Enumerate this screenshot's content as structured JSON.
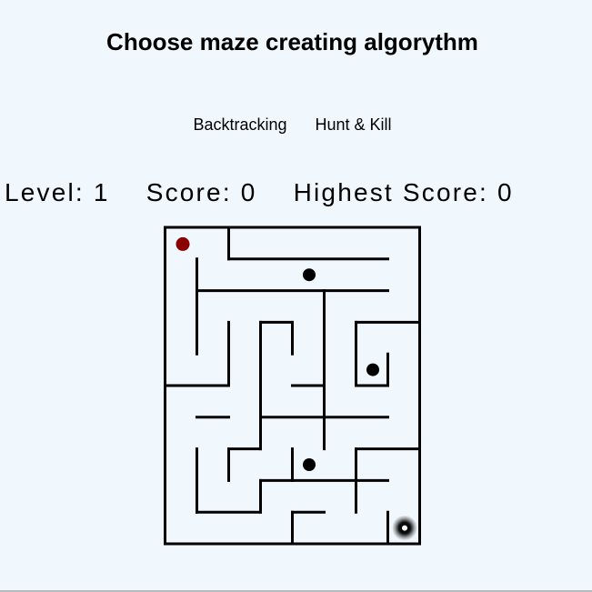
{
  "header": {
    "title": "Choose maze creating algorythm"
  },
  "algorithms": [
    {
      "label": "Backtracking"
    },
    {
      "label": "Hunt & Kill"
    }
  ],
  "stats": {
    "level_label": "Level:",
    "level": "1",
    "score_label": "Score:",
    "score": "0",
    "highest_label": "Highest Score:",
    "highest": "0"
  },
  "maze": {
    "columns": 8,
    "rows": 10,
    "wall_color": "#000000",
    "player_color": "#8b0000",
    "coin_color": "#000000",
    "goal_color": "#000000",
    "player_cell": {
      "col": 0,
      "row": 0
    },
    "coin_cells": [
      {
        "col": 4,
        "row": 1
      },
      {
        "col": 6,
        "row": 4
      },
      {
        "col": 4,
        "row": 7
      }
    ],
    "goal_cell": {
      "col": 7,
      "row": 9
    }
  }
}
